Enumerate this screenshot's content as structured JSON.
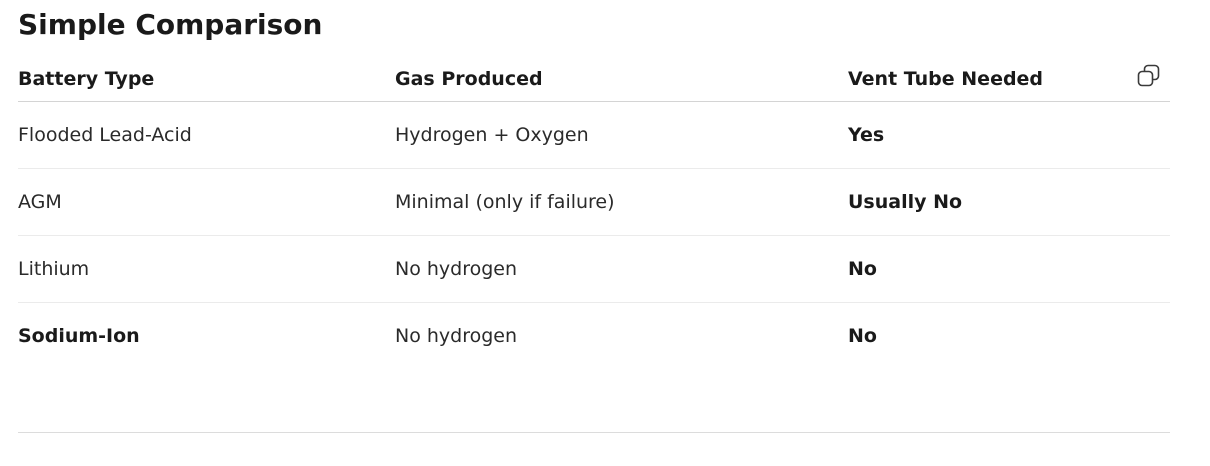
{
  "heading": "Simple Comparison",
  "table": {
    "headers": [
      "Battery Type",
      "Gas Produced",
      "Vent Tube Needed"
    ],
    "rows": [
      [
        "Flooded Lead-Acid",
        "Hydrogen + Oxygen",
        "Yes"
      ],
      [
        "AGM",
        "Minimal (only if failure)",
        "Usually No"
      ],
      [
        "Lithium",
        "No hydrogen",
        "No"
      ],
      [
        "Sodium-Ion",
        "No hydrogen",
        "No"
      ]
    ]
  },
  "icons": {
    "copy": "copy-icon"
  }
}
